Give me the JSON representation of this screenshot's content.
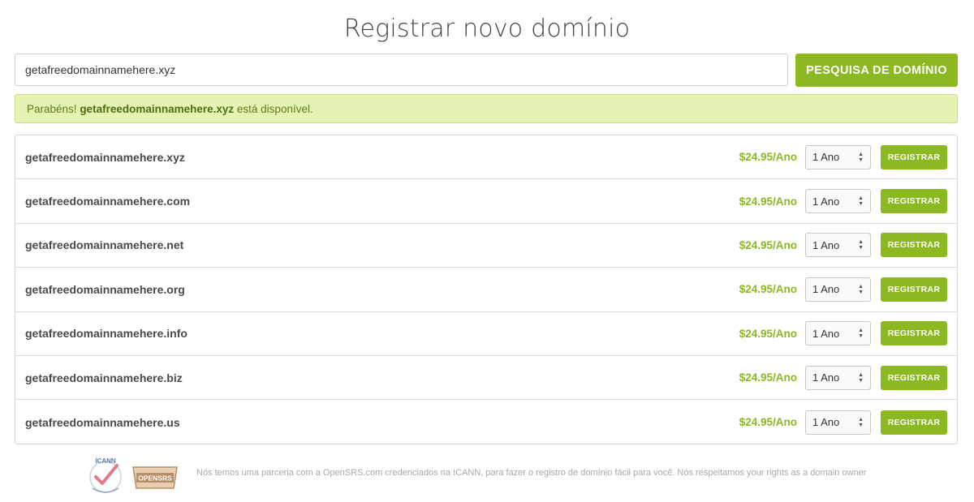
{
  "page": {
    "title": "Registrar novo domínio"
  },
  "search": {
    "value": "getafreedomainnamehere.xyz",
    "button_label": "PESQUISA DE DOMÍNIO"
  },
  "alert": {
    "prefix": "Parabéns! ",
    "domain": "getafreedomainnamehere.xyz",
    "suffix": " está disponível."
  },
  "results": [
    {
      "domain": "getafreedomainnamehere.xyz",
      "price": "$24.95/Ano",
      "period": "1 Ano",
      "button": "REGISTRAR"
    },
    {
      "domain": "getafreedomainnamehere.com",
      "price": "$24.95/Ano",
      "period": "1 Ano",
      "button": "REGISTRAR"
    },
    {
      "domain": "getafreedomainnamehere.net",
      "price": "$24.95/Ano",
      "period": "1 Ano",
      "button": "REGISTRAR"
    },
    {
      "domain": "getafreedomainnamehere.org",
      "price": "$24.95/Ano",
      "period": "1 Ano",
      "button": "REGISTRAR"
    },
    {
      "domain": "getafreedomainnamehere.info",
      "price": "$24.95/Ano",
      "period": "1 Ano",
      "button": "REGISTRAR"
    },
    {
      "domain": "getafreedomainnamehere.biz",
      "price": "$24.95/Ano",
      "period": "1 Ano",
      "button": "REGISTRAR"
    },
    {
      "domain": "getafreedomainnamehere.us",
      "price": "$24.95/Ano",
      "period": "1 Ano",
      "button": "REGISTRAR"
    }
  ],
  "footer": {
    "text": "Nós temos uma parceria com a OpenSRS.com credenciados na ICANN, para fazer o registro de domínio fácil para você. Nós respeitamos your rights as a domain owner",
    "icann_logo": "ICANN",
    "opensrs_logo": "OPENSRS"
  },
  "colors": {
    "accent": "#8cb822",
    "alert_bg": "#e4f3b4",
    "alert_text": "#5b7d14"
  },
  "icons": {
    "select_arrows": "up-down-chevron-icon",
    "icann": "icann-accredited-logo-icon",
    "opensrs": "opensrs-logo-icon"
  }
}
